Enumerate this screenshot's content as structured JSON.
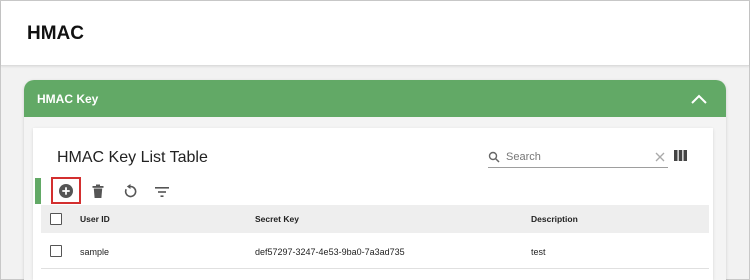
{
  "page": {
    "title": "HMAC"
  },
  "panel": {
    "title": "HMAC Key"
  },
  "table": {
    "title": "HMAC Key List Table",
    "search_placeholder": "Search",
    "columns": [
      "User ID",
      "Secret Key",
      "Description"
    ],
    "rows": [
      {
        "user_id": "sample",
        "secret_key": "def57297-3247-4e53-9ba0-7a3ad735",
        "description": "test"
      }
    ]
  },
  "toolbar": {
    "icons": [
      "add-circle-icon",
      "trash-icon",
      "refresh-icon",
      "filter-icon"
    ]
  },
  "colors": {
    "accent_green": "#62a966",
    "highlight_red": "#d32f2f",
    "header_bg": "#ffffff",
    "table_header_bg": "#eeeeee"
  }
}
